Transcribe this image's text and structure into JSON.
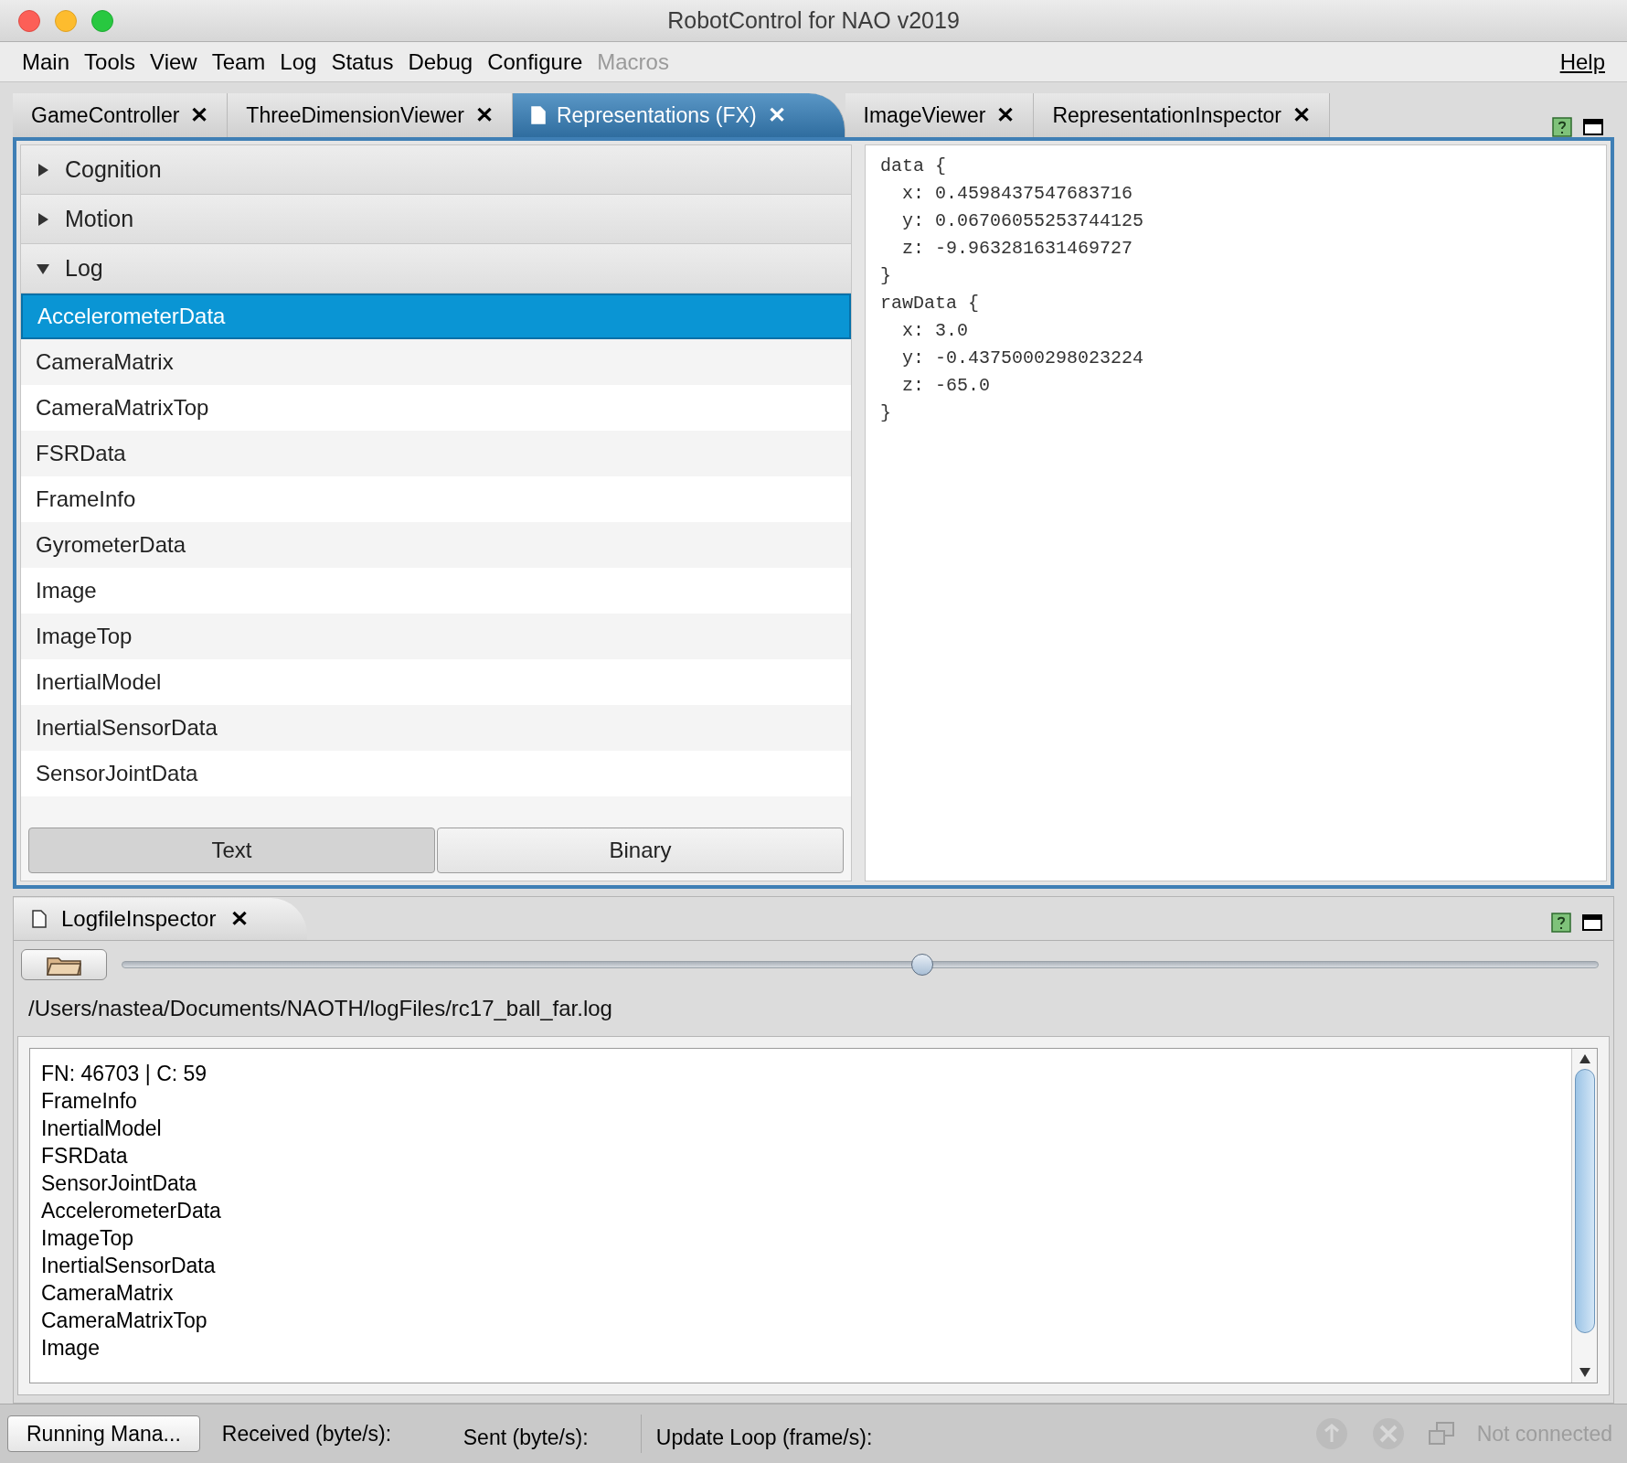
{
  "window": {
    "title": "RobotControl for NAO v2019"
  },
  "menu": [
    {
      "label": "Main",
      "disabled": false
    },
    {
      "label": "Tools",
      "disabled": false
    },
    {
      "label": "View",
      "disabled": false
    },
    {
      "label": "Team",
      "disabled": false
    },
    {
      "label": "Log",
      "disabled": false
    },
    {
      "label": "Status",
      "disabled": false
    },
    {
      "label": "Debug",
      "disabled": false
    },
    {
      "label": "Configure",
      "disabled": false
    },
    {
      "label": "Macros",
      "disabled": true
    }
  ],
  "help_menu": "Help",
  "tabs": [
    {
      "label": "GameController",
      "selected": false,
      "close": "✕"
    },
    {
      "label": "ThreeDimensionViewer",
      "selected": false,
      "close": "✕"
    },
    {
      "label": "Representations (FX)",
      "selected": true,
      "close": "✕"
    },
    {
      "label": "ImageViewer",
      "selected": false,
      "close": "✕"
    },
    {
      "label": "RepresentationInspector",
      "selected": false,
      "close": "✕"
    }
  ],
  "categories": [
    {
      "label": "Cognition",
      "expanded": false
    },
    {
      "label": "Motion",
      "expanded": false
    },
    {
      "label": "Log",
      "expanded": true,
      "items": [
        {
          "label": "AccelerometerData",
          "selected": true
        },
        {
          "label": "CameraMatrix",
          "selected": false
        },
        {
          "label": "CameraMatrixTop",
          "selected": false
        },
        {
          "label": "FSRData",
          "selected": false
        },
        {
          "label": "FrameInfo",
          "selected": false
        },
        {
          "label": "GyrometerData",
          "selected": false
        },
        {
          "label": "Image",
          "selected": false
        },
        {
          "label": "ImageTop",
          "selected": false
        },
        {
          "label": "InertialModel",
          "selected": false
        },
        {
          "label": "InertialSensorData",
          "selected": false
        },
        {
          "label": "SensorJointData",
          "selected": false
        }
      ]
    }
  ],
  "format_buttons": [
    {
      "label": "Text",
      "selected": true
    },
    {
      "label": "Binary",
      "selected": false
    }
  ],
  "representation_text": [
    "data {",
    "  x: 0.4598437547683716",
    "  y: 0.06706055253744125",
    "  z: -9.963281631469727",
    "}",
    "rawData {",
    "  x: 3.0",
    "  y: -0.4375000298023224",
    "  z: -65.0",
    "}"
  ],
  "logfile_inspector": {
    "tab": {
      "label": "LogfileInspector",
      "close": "✕"
    },
    "slider": {
      "level": 0.542
    },
    "path": "/Users/nastea/Documents/NAOTH/logFiles/rc17_ball_far.log",
    "log_lines": [
      "FN: 46703 | C: 59",
      "FrameInfo",
      "InertialModel",
      "FSRData",
      "SensorJointData",
      "AccelerometerData",
      "ImageTop",
      "InertialSensorData",
      "CameraMatrix",
      "CameraMatrixTop",
      "Image"
    ]
  },
  "status_bar": {
    "button": "Running Mana...",
    "received": "Received (byte/s):",
    "sent": "Sent (byte/s):",
    "update_loop": "Update Loop (frame/s):",
    "connection": "Not connected"
  }
}
